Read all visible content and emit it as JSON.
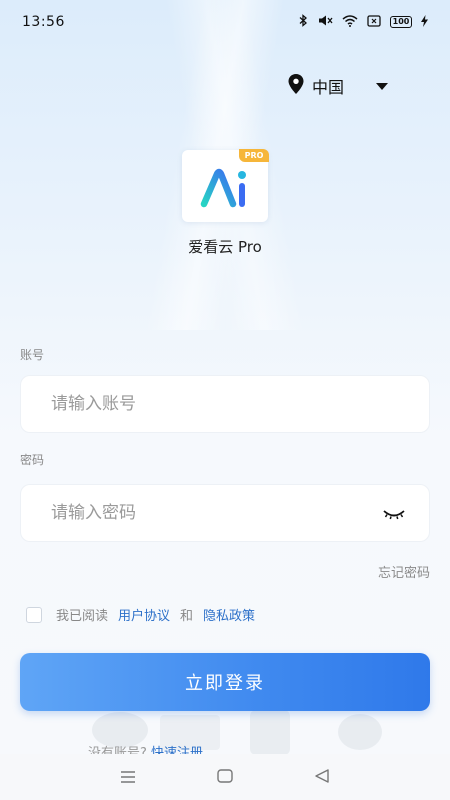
{
  "status_bar": {
    "time": "13:56",
    "battery": "100",
    "icons": [
      "bluetooth-icon",
      "mute-icon",
      "wifi-icon",
      "sim-icon",
      "battery-icon",
      "charging-icon"
    ]
  },
  "region": {
    "label": "中国"
  },
  "app": {
    "name": "爱看云 Pro",
    "badge": "PRO"
  },
  "form": {
    "account_label": "账号",
    "account_placeholder": "请输入账号",
    "password_label": "密码",
    "password_placeholder": "请输入密码",
    "forgot_password": "忘记密码"
  },
  "agreement": {
    "prefix": "我已阅读",
    "user_agreement": "用户协议",
    "and": "和",
    "privacy_policy": "隐私政策"
  },
  "login_button": "立即登录",
  "register": {
    "prompt": "没有账号?",
    "link": "快速注册"
  },
  "colors": {
    "accent": "#3f89ef",
    "link": "#2d71c9",
    "badge": "#f6b63a"
  }
}
